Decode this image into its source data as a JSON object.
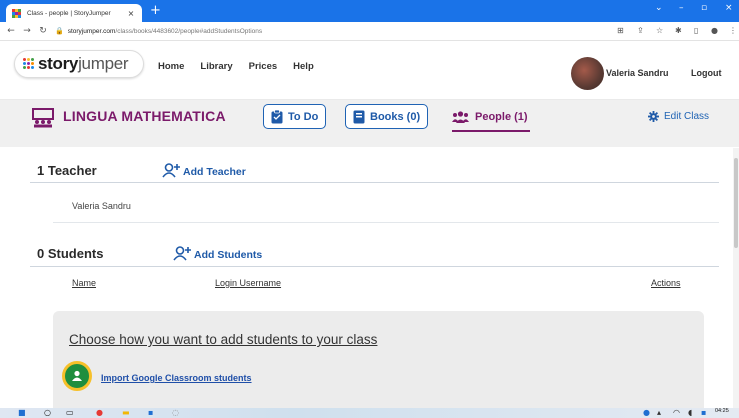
{
  "browser": {
    "tab_title": "Class - people | StoryJumper",
    "tab_close": "×",
    "new_tab": "+",
    "url_host": "storyjumper.com",
    "url_path": "/class/books/4483602/people#addStudentsOptions",
    "win_minimize": "–",
    "win_maximize": "▫",
    "win_close": "×",
    "win_dropdown": "⌄"
  },
  "header": {
    "logo_bold": "story",
    "logo_light": "jumper",
    "nav": [
      "Home",
      "Library",
      "Prices",
      "Help"
    ],
    "user_name": "Valeria Sandru",
    "logout": "Logout"
  },
  "class_bar": {
    "class_name": "LINGUA MATHEMATICA",
    "todo_label": "To Do",
    "books_label": "Books (0)",
    "people_label": "People (1)",
    "edit_label": "Edit Class"
  },
  "teachers": {
    "title": "1 Teacher",
    "add_label": "Add Teacher",
    "rows": [
      "Valeria Sandru"
    ]
  },
  "students": {
    "title": "0 Students",
    "add_label": "Add Students",
    "columns": [
      "Name",
      "Login Username",
      "Actions"
    ]
  },
  "add_panel": {
    "title": "Choose how you want to add students to your class",
    "import_label": "Import Google Classroom students"
  },
  "taskbar": {
    "time": "04:25"
  },
  "colors": {
    "browser_blue": "#1a73e8",
    "class_purple": "#7b1a6a",
    "link_blue": "#1f5aa8",
    "google_green": "#1e8e3e"
  }
}
